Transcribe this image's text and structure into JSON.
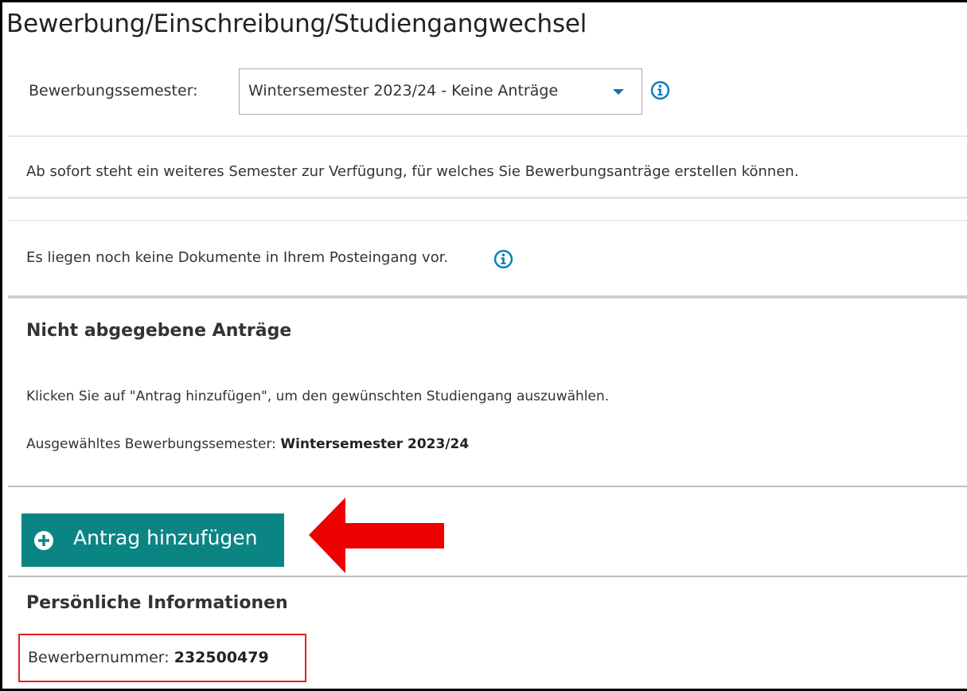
{
  "page": {
    "title": "Bewerbung/Einschreibung/Studiengangwechsel"
  },
  "semester_select": {
    "label": "Bewerbungssemester:",
    "selected": "Wintersemester 2023/24 - Keine Anträge"
  },
  "notices": {
    "new_semester": "Ab sofort steht ein weiteres Semester zur Verfügung, für welches Sie Bewerbungsanträge erstellen können.",
    "posteingang": "Es liegen noch keine Dokumente in Ihrem Posteingang vor."
  },
  "applications": {
    "heading": "Nicht abgegebene Anträge",
    "instruction": "Klicken Sie auf \"Antrag hinzufügen\", um den gewünschten Studiengang auszuwählen.",
    "selected_semester_label": "Ausgewähltes Bewerbungssemester:",
    "selected_semester_value": "Wintersemester 2023/24",
    "add_button_label": "Antrag hinzufügen"
  },
  "personal": {
    "heading": "Persönliche Informationen",
    "applicant_number_label": "Bewerbernummer:",
    "applicant_number_value": "232500479"
  },
  "colors": {
    "button_bg": "#0b8484",
    "info_icon": "#0f7db8",
    "arrow": "#ee0000",
    "highlight_border": "#e02020"
  },
  "icons": {
    "dropdown": "chevron-down-icon",
    "info": "info-icon",
    "add": "plus-circle-icon",
    "annotation": "red-arrow-left"
  }
}
